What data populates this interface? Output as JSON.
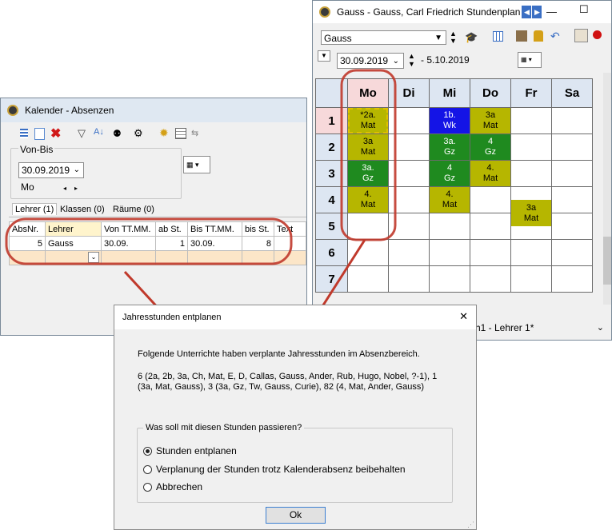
{
  "timetable_window": {
    "title": "Gauss - Gauss, Carl Friedrich  Stundenplan",
    "teacher_select": "Gauss",
    "date_from": "30.09.2019",
    "date_to": "- 5.10.2019",
    "bottom_select": "h1 - Lehrer 1*",
    "days": [
      "Mo",
      "Di",
      "Mi",
      "Do",
      "Fr",
      "Sa"
    ],
    "periods": [
      "1",
      "2",
      "3",
      "4",
      "5",
      "6",
      "7"
    ],
    "lessons": {
      "mo1": [
        "*2a.",
        "Mat"
      ],
      "mo2": [
        "3a",
        "Mat"
      ],
      "mo3": [
        "3a.",
        "Gz"
      ],
      "mo4": [
        "4.",
        "Mat"
      ],
      "mi1": [
        "1b.",
        "Wk"
      ],
      "mi2": [
        "3a.",
        "Gz"
      ],
      "mi3": [
        "4",
        "Gz"
      ],
      "mi4": [
        "4.",
        "Mat"
      ],
      "do1": [
        "3a",
        "Mat"
      ],
      "do2": [
        "4",
        "Gz"
      ],
      "do3": [
        "4.",
        "Mat"
      ],
      "fr4": [
        "3a",
        "Mat"
      ]
    },
    "colors": {
      "olive": "#b6b600",
      "green": "#1f8a1f",
      "blue": "#1414e6",
      "highlight": "#c0392b"
    }
  },
  "calendar_window": {
    "title": "Kalender - Absenzen",
    "group_label": "Von-Bis",
    "date": "30.09.2019",
    "weekday": "Mo",
    "tabs": [
      "Lehrer (1)",
      "Klassen (0)",
      "Räume (0)"
    ],
    "columns": [
      "AbsNr.",
      "Lehrer",
      "Von TT.MM.",
      "ab St.",
      "Bis TT.MM.",
      "bis St.",
      "Text"
    ],
    "rows": [
      [
        "5",
        "Gauss",
        "30.09.",
        "1",
        "30.09.",
        "8",
        ""
      ]
    ]
  },
  "dialog": {
    "title": "Jahresstunden entplanen",
    "close": "✕",
    "message": "Folgende Unterrichte haben verplante Jahresstunden im Absenzbereich.",
    "details": "6 (2a, 2b, 3a, Ch, Mat, E, D, Callas, Gauss, Ander, Rub, Hugo, Nobel, ?-1), 1 (3a, Mat, Gauss), 3 (3a, Gz, Tw, Gauss, Curie), 82 (4, Mat, Ander, Gauss)",
    "group_label": "Was soll mit diesen Stunden passieren?",
    "options": [
      "Stunden entplanen",
      "Verplanung der Stunden trotz Kalenderabsenz beibehalten",
      "Abbrechen"
    ],
    "ok": "Ok"
  }
}
